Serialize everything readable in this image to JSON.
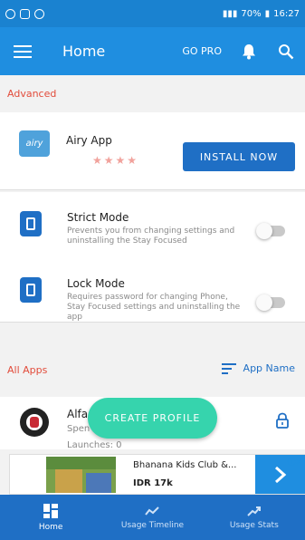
{
  "status_bar": {
    "battery": "70%",
    "time": "16:27"
  },
  "app_bar": {
    "title": "Home",
    "go_pro": "GO PRO"
  },
  "sections": {
    "advanced": "Advanced",
    "all_apps": "All Apps",
    "sort_label": "App Name"
  },
  "ad_app": {
    "logo_text": "airy",
    "title": "Airy App",
    "rating": 4,
    "rating_max": 5,
    "stars_text": "★★★★",
    "install_label": "INSTALL NOW"
  },
  "modes": [
    {
      "title": "Strict Mode",
      "description": "Prevents you from changing settings and uninstalling the Stay Focused",
      "enabled": false
    },
    {
      "title": "Lock Mode",
      "description": "Requires password for changing Phone, Stay Focused settings and uninstalling the app",
      "enabled": false
    }
  ],
  "apps": [
    {
      "name": "Alfa",
      "spent": "Spen",
      "launches": "Launches: 0"
    }
  ],
  "fab": {
    "label": "CREATE PROFILE"
  },
  "ad_banner": {
    "title": "Bhanana Kids Club &...",
    "price": "IDR 17k"
  },
  "bottom_nav": [
    {
      "label": "Home",
      "icon": "dashboard-icon",
      "active": true
    },
    {
      "label": "Usage Timeline",
      "icon": "timeline-icon",
      "active": false
    },
    {
      "label": "Usage Stats",
      "icon": "stats-icon",
      "active": false
    }
  ],
  "colors": {
    "primary": "#1f8ee0",
    "primary_dark": "#1f6fc5",
    "accent": "#36d4ad",
    "section_red": "#e24c3b"
  }
}
